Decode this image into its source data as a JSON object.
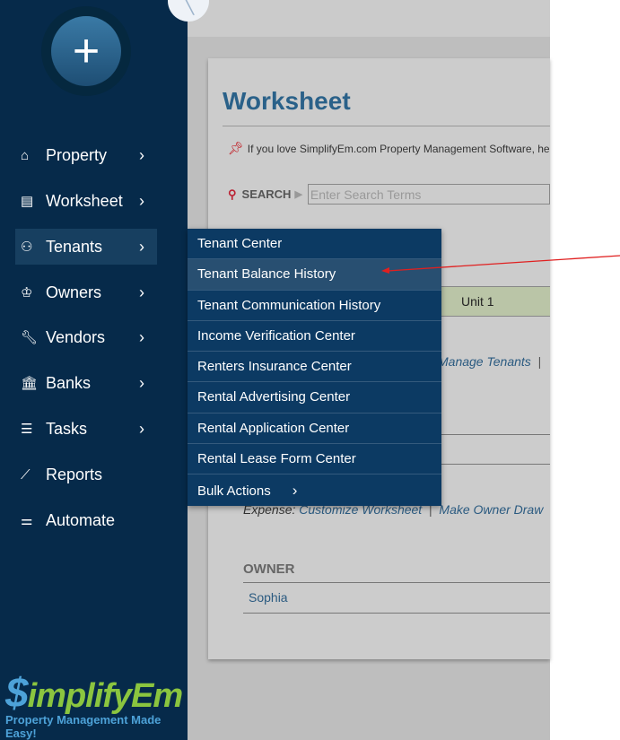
{
  "sidebar": {
    "add_icon": "plus-icon",
    "items": [
      {
        "label": "Property",
        "icon": "home-icon"
      },
      {
        "label": "Worksheet",
        "icon": "table-icon"
      },
      {
        "label": "Tenants",
        "icon": "users-icon"
      },
      {
        "label": "Owners",
        "icon": "crown-icon"
      },
      {
        "label": "Vendors",
        "icon": "wrench-icon"
      },
      {
        "label": "Banks",
        "icon": "bank-icon"
      },
      {
        "label": "Tasks",
        "icon": "tasks-icon"
      },
      {
        "label": "Reports",
        "icon": "chart-line-icon"
      },
      {
        "label": "Automate",
        "icon": "sliders-icon"
      }
    ],
    "logo": {
      "brand": "SimplifyEm",
      "tagline": "Property Management Made Easy!"
    }
  },
  "page": {
    "title": "Worksheet",
    "promo": "If you love SimplifyEm.com Property Management Software, he",
    "search_label": "SEARCH",
    "search_placeholder": "Enter Search Terms",
    "unit": "Unit 1",
    "manage_tenants": "Manage Tenants",
    "separator": "|",
    "expense_label": "Expense:",
    "customize_worksheet": "Customize Worksheet",
    "make_owner_draw": "Make Owner Draw",
    "owner_heading": "OWNER",
    "owner_name": "Sophia"
  },
  "tenants_menu": {
    "items": [
      "Tenant Center",
      "Tenant Balance History",
      "Tenant Communication History",
      "Income Verification Center",
      "Renters Insurance Center",
      "Rental Advertising Center",
      "Rental Application Center",
      "Rental Lease Form Center",
      "Bulk Actions"
    ],
    "highlighted": "Tenant Balance History"
  },
  "colors": {
    "sidebar": "#062a4a",
    "menu": "#0c3a63",
    "title": "#2a6189",
    "arrow": "#e02020",
    "logo_green": "#8bc53f",
    "logo_blue": "#4da2d8"
  }
}
